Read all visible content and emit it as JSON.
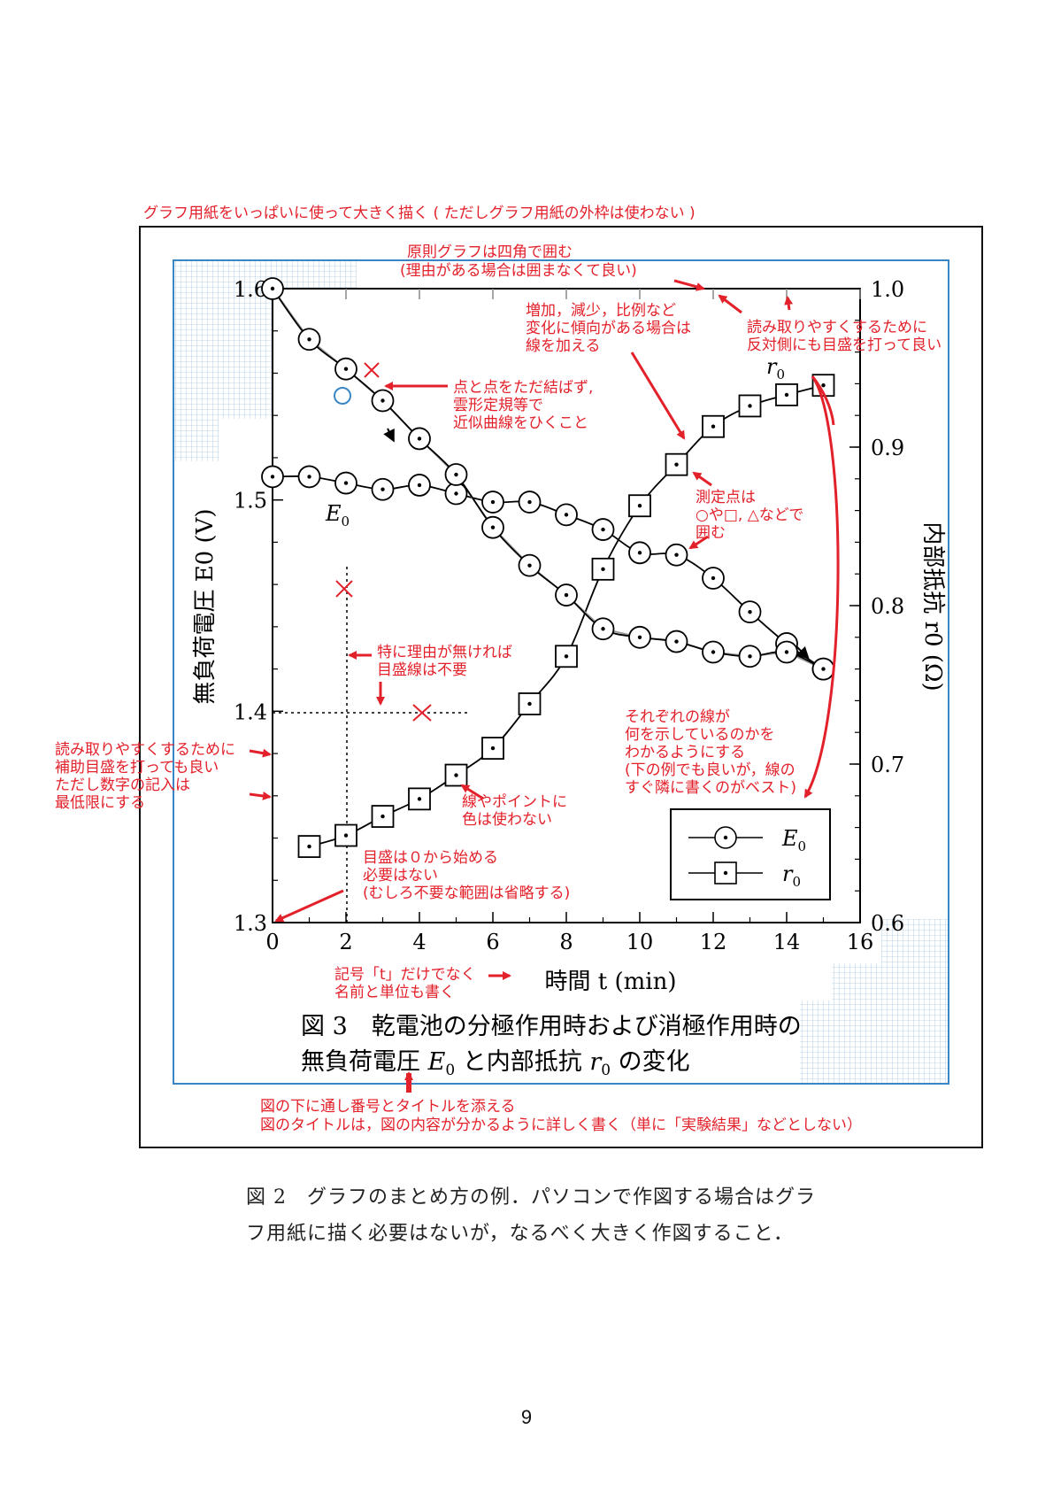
{
  "chart_data": {
    "type": "line",
    "x_axis": {
      "label": "時間 t (min)",
      "range": [
        0,
        16
      ],
      "ticks": [
        "0",
        "2",
        "4",
        "6",
        "8",
        "10",
        "12",
        "14",
        "16"
      ]
    },
    "y_left": {
      "label": "無負荷電圧 E0 (V)",
      "range": [
        1.3,
        1.6
      ],
      "ticks": [
        "1.3",
        "1.4",
        "1.5",
        "1.6"
      ]
    },
    "y_right": {
      "label": "内部抵抗 r0 (Ω)",
      "range": [
        0.6,
        1.0
      ],
      "ticks": [
        "0.6",
        "0.7",
        "0.8",
        "0.9",
        "1.0"
      ]
    },
    "series": [
      {
        "name": "E0",
        "marker": "circle-dot",
        "axis": "left",
        "x": [
          0,
          1,
          2,
          3,
          4,
          5,
          6,
          7,
          8,
          9,
          10,
          11,
          12,
          13,
          14,
          15
        ],
        "y": [
          1.511,
          1.511,
          1.508,
          1.505,
          1.507,
          1.503,
          1.499,
          1.499,
          1.493,
          1.486,
          1.475,
          1.474,
          1.463,
          1.447,
          1.432,
          1.42
        ]
      },
      {
        "name": "r0",
        "marker": "square-dot",
        "axis": "right",
        "x": [
          1,
          2,
          3,
          4,
          5,
          6,
          7,
          8,
          9,
          10,
          11,
          12,
          13,
          14,
          15
        ],
        "y": [
          0.648,
          0.655,
          0.667,
          0.678,
          0.693,
          0.71,
          0.738,
          0.768,
          0.823,
          0.863,
          0.889,
          0.913,
          0.926,
          0.933,
          0.939
        ]
      },
      {
        "name": "E0 (polarizing)",
        "marker": "circle-dot",
        "axis": "left",
        "x": [
          0,
          1,
          2,
          3,
          4,
          5,
          6,
          7,
          8,
          9,
          10,
          11,
          12,
          13,
          14,
          15
        ],
        "y": [
          1.6,
          1.576,
          1.562,
          1.547,
          1.529,
          1.512,
          1.487,
          1.469,
          1.455,
          1.439,
          1.435,
          1.433,
          1.428,
          1.426,
          1.428,
          1.42
        ]
      }
    ],
    "legend": {
      "position": "bottom-right",
      "entries": [
        "E0",
        "r0"
      ]
    },
    "series_labels": {
      "e0": "E",
      "e0_sub": "0",
      "r0": "r",
      "r0_sub": "0"
    },
    "grid": false,
    "figure_caption": {
      "line1": "図 3　乾電池の分極作用時および消極作用時の",
      "line2_a": "無負荷電圧 ",
      "line2_b": " と内部抵抗 ",
      "line2_c": " の変化"
    }
  },
  "annotations": {
    "top_note": "グラフ用紙をいっぱいに使って大きく描く ( ただしグラフ用紙の外枠は使わない )",
    "frame_note_1": "原則グラフは四角で囲む",
    "frame_note_2": "(理由がある場合は囲まなくて良い)",
    "trend_note": [
      "増加，減少，比例など",
      "変化に傾向がある場合は",
      "線を加える"
    ],
    "opposite_note": [
      "読み取りやすくするために",
      "反対側にも目盛を打って良い"
    ],
    "curve_note": [
      "点と点をただ結ばず,",
      "雲形定規等で",
      "近似曲線をひくこと"
    ],
    "marker_note": [
      "測定点は",
      "○や□, △などで",
      "囲む"
    ],
    "gridline_note": [
      "特に理由が無ければ",
      "目盛線は不要"
    ],
    "minor_tick_note": [
      "読み取りやすくするために",
      "補助目盛を打っても良い",
      "ただし数字の記入は",
      "最低限にする"
    ],
    "color_note": [
      "線やポイントに",
      "色は使わない"
    ],
    "label_note": [
      "それぞれの線が",
      "何を示しているのかを",
      "わかるようにする",
      "(下の例でも良いが，線の",
      "すぐ隣に書くのがベスト)"
    ],
    "zero_note": [
      "目盛は０から始める",
      "必要はない",
      "(むしろ不要な範囲は省略する)"
    ],
    "axis_name_note": [
      "記号「t」だけでなく",
      "名前と単位も書く"
    ],
    "title_note": [
      "図の下に通し番号とタイトルを添える",
      "図のタイトルは，図の内容が分かるように詳しく書く（単に「実験結果」などとしない）"
    ]
  },
  "caption": {
    "line1": "図 2　グラフのまとめ方の例．パソコンで作図する場合はグラ",
    "line2": "フ用紙に描く必要はないが，なるべく大きく作図すること．"
  },
  "page_number": "9"
}
